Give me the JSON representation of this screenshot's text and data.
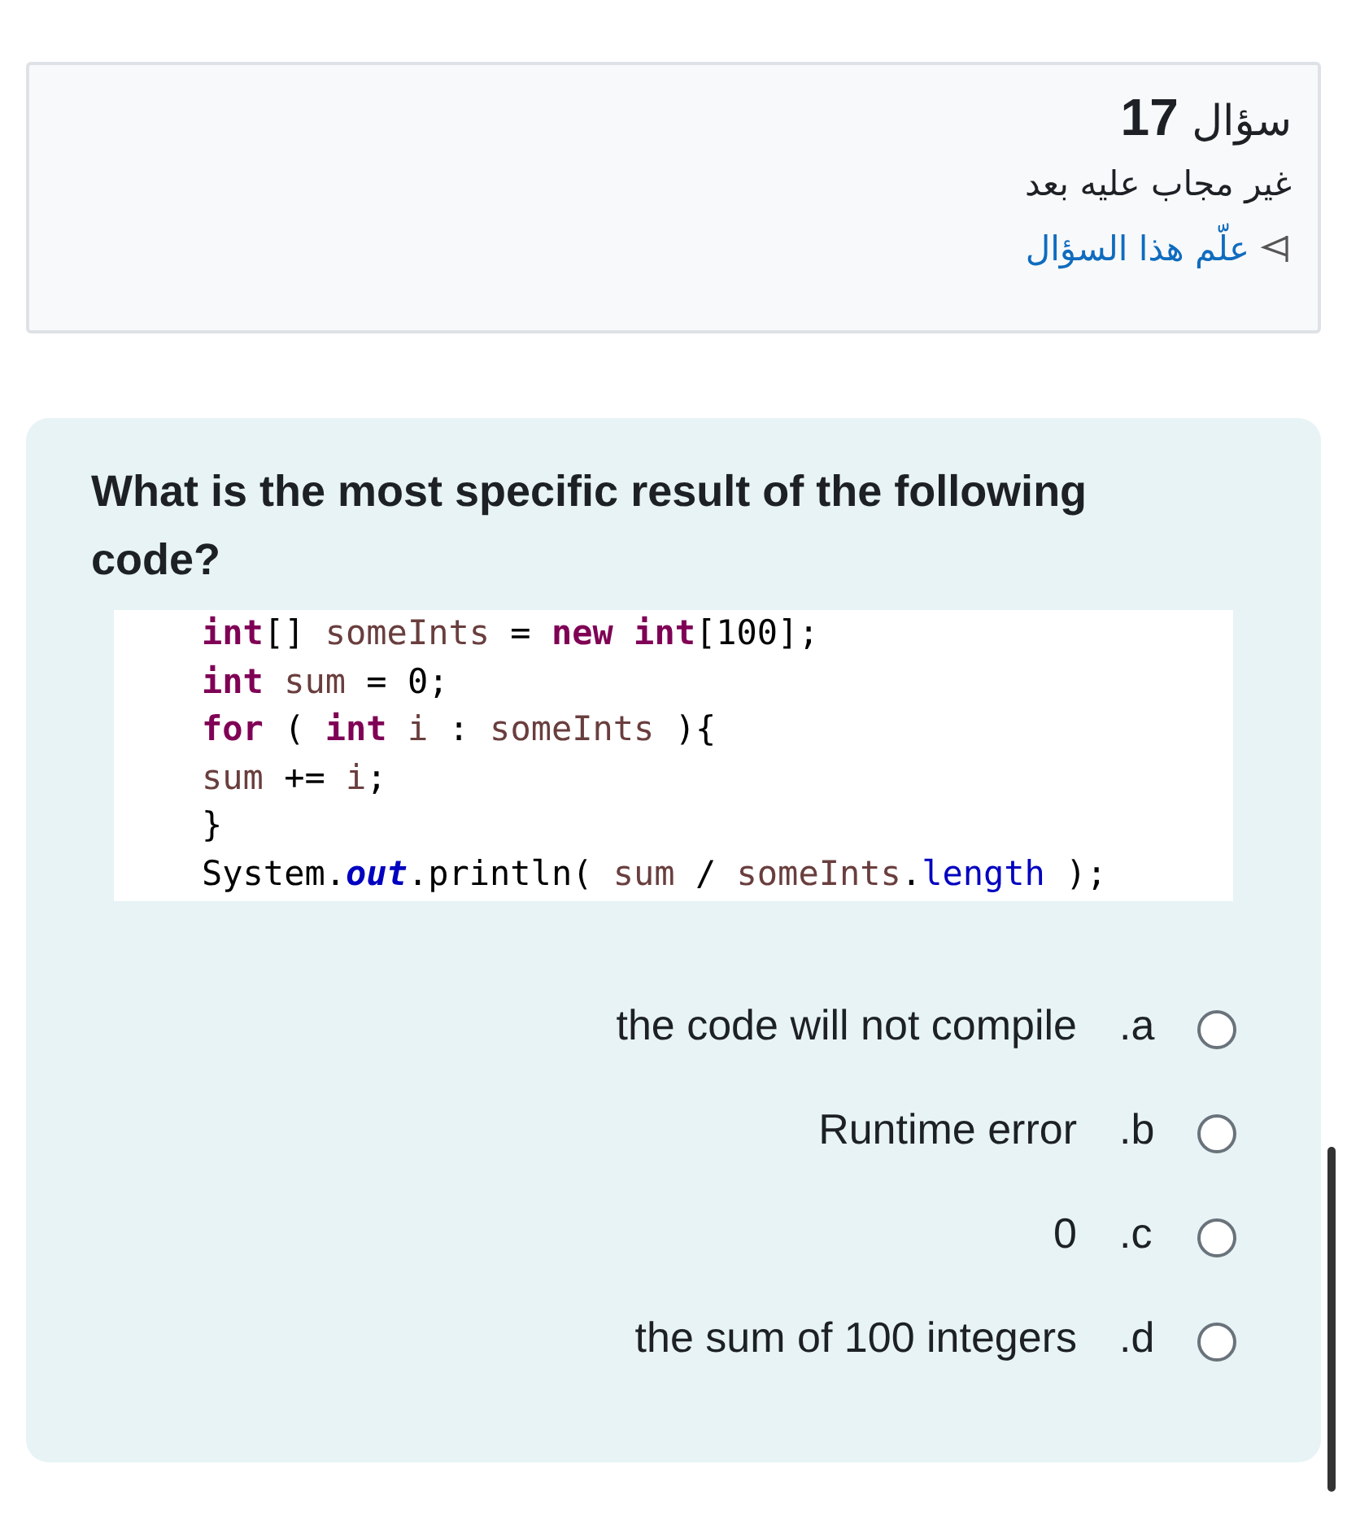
{
  "info": {
    "title": "سؤال",
    "number": "17",
    "status": "غير مجاب عليه بعد",
    "flag_link": "علّم هذا السؤال"
  },
  "question": {
    "text": "What is the most specific result of the following code?",
    "code": [
      [
        {
          "kind": "keyword",
          "text": "int"
        },
        {
          "kind": "plain",
          "text": "[] "
        },
        {
          "kind": "ident",
          "text": "someInts"
        },
        {
          "kind": "plain",
          "text": " = "
        },
        {
          "kind": "keyword",
          "text": "new"
        },
        {
          "kind": "keyword",
          "text": " int"
        },
        {
          "kind": "plain",
          "text": "[100];"
        }
      ],
      [
        {
          "kind": "keyword",
          "text": "int"
        },
        {
          "kind": "ident",
          "text": " sum"
        },
        {
          "kind": "plain",
          "text": " = 0;"
        }
      ],
      [
        {
          "kind": "keyword",
          "text": "for"
        },
        {
          "kind": "plain",
          "text": " ( "
        },
        {
          "kind": "keyword",
          "text": "int"
        },
        {
          "kind": "ident",
          "text": " i"
        },
        {
          "kind": "plain",
          "text": " : "
        },
        {
          "kind": "ident",
          "text": "someInts"
        },
        {
          "kind": "plain",
          "text": " ){"
        }
      ],
      [
        {
          "kind": "ident",
          "text": "sum"
        },
        {
          "kind": "plain",
          "text": " += "
        },
        {
          "kind": "ident",
          "text": "i"
        },
        {
          "kind": "plain",
          "text": ";"
        }
      ],
      [
        {
          "kind": "plain",
          "text": "}"
        }
      ],
      [
        {
          "kind": "plain",
          "text": "System."
        },
        {
          "kind": "static",
          "text": "out"
        },
        {
          "kind": "plain",
          "text": ".println( "
        },
        {
          "kind": "ident",
          "text": "sum"
        },
        {
          "kind": "plain",
          "text": " / "
        },
        {
          "kind": "ident",
          "text": "someInts"
        },
        {
          "kind": "plain",
          "text": "."
        },
        {
          "kind": "field",
          "text": "length"
        },
        {
          "kind": "plain",
          "text": " );"
        }
      ]
    ],
    "options": [
      {
        "letter": ".a",
        "text": "the code will not compile",
        "selected": false
      },
      {
        "letter": ".b",
        "text": "Runtime error",
        "selected": false
      },
      {
        "letter": ".c",
        "text": "0",
        "selected": false
      },
      {
        "letter": ".d",
        "text": "the sum of 100 integers",
        "selected": false
      }
    ]
  }
}
